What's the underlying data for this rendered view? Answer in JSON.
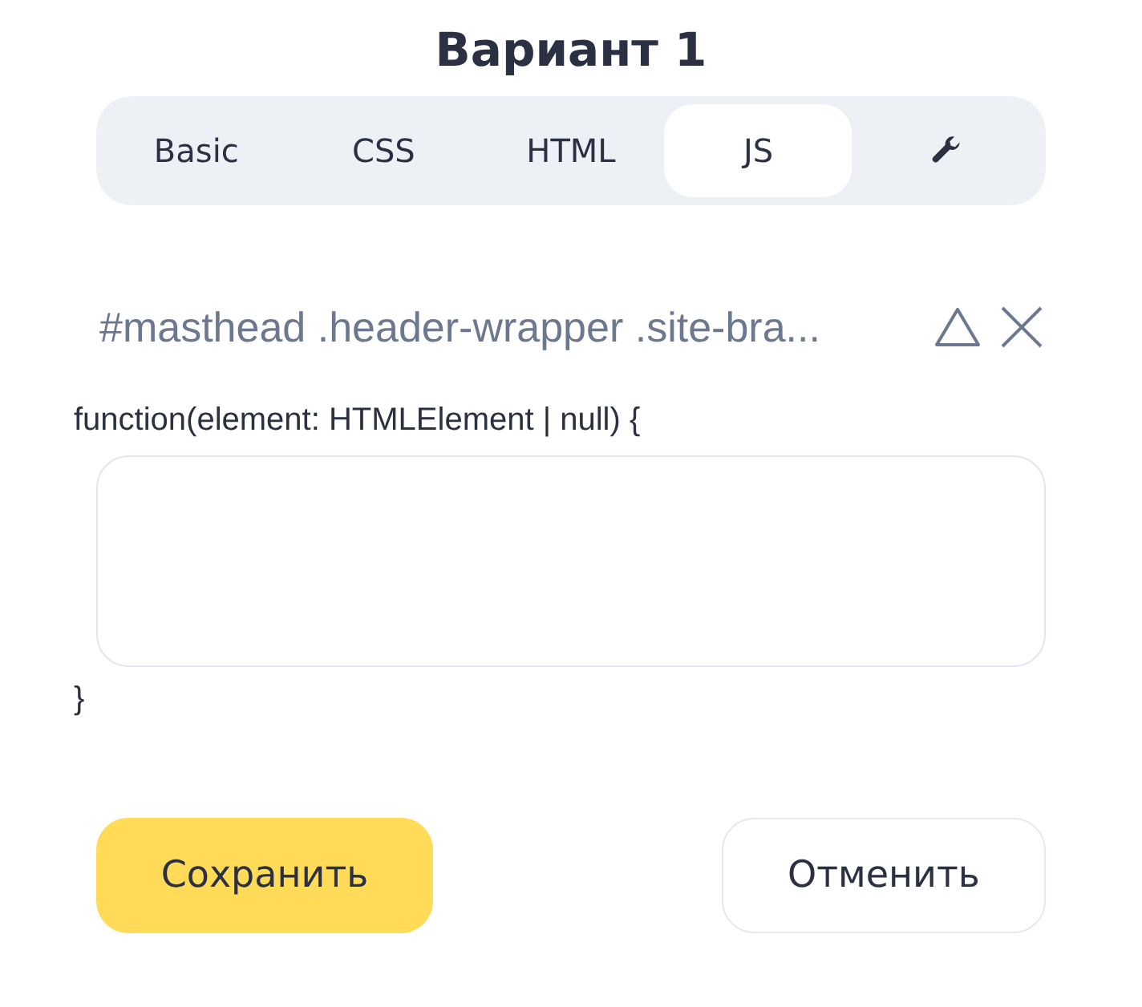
{
  "title": "Вариант 1",
  "tabs": [
    {
      "kind": "text",
      "label": "Basic",
      "selected": false
    },
    {
      "kind": "text",
      "label": "CSS",
      "selected": false
    },
    {
      "kind": "text",
      "label": "HTML",
      "selected": false
    },
    {
      "kind": "text",
      "label": "JS",
      "selected": true
    },
    {
      "kind": "icon",
      "selected": false
    }
  ],
  "selector": "#masthead .header-wrapper .site-bra...",
  "code": {
    "header": "function(element: HTMLElement | null) {",
    "footer": "}"
  },
  "buttons": [
    {
      "kind": "primary",
      "label": "Сохранить"
    },
    {
      "kind": "secondary",
      "label": "Отменить"
    }
  ]
}
